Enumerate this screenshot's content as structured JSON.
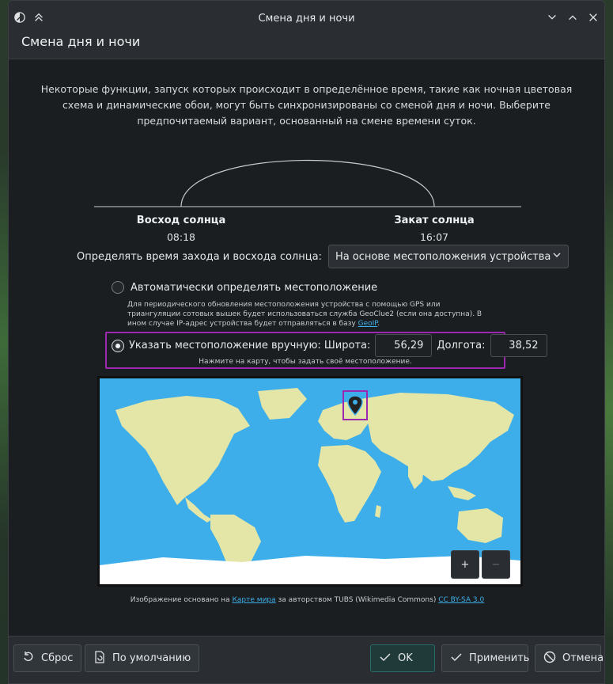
{
  "window": {
    "title": "Смена дня и ночи"
  },
  "header": {
    "title": "Смена дня и ночи"
  },
  "description": "Некоторые функции, запуск которых происходит в определённое время, такие как ночная цветовая схема и динамические обои, могут быть синхронизированы со сменой дня и ночи. Выберите предпочитаемый вариант, основанный на смене времени суток.",
  "sunrise": {
    "label": "Восход солнца",
    "time": "08:18"
  },
  "sunset": {
    "label": "Закат солнца",
    "time": "16:07"
  },
  "mode": {
    "label": "Определять время захода и восхода солнца:",
    "selected": "На основе местоположения устройства"
  },
  "auto_location": {
    "label": "Автоматически определять местоположение",
    "note_text": "Для периодического обновления местоположения устройства с помощью GPS или триангуляции сотовых вышек будет использоваться служба GeoClue2 (если она доступна). В ином случае IP-адрес устройства будет отправляться в базу",
    "note_link": "GeoIP",
    "note_end": ".",
    "checked": false
  },
  "manual_location": {
    "label": "Указать местоположение вручную: Широта:",
    "latitude": "56,29",
    "longitude_label": "Долгота:",
    "longitude": "38,52",
    "note": "Нажмите на карту, чтобы задать своё местоположение.",
    "checked": true
  },
  "map": {
    "zoom_in_label": "+",
    "zoom_out_label": "−",
    "water_color": "#3daee9",
    "land_color": "#e4e6a8",
    "ice_color": "#ffffff",
    "highlight_color": "#9c27b0"
  },
  "credit": {
    "prefix": "Изображение основано на ",
    "link1": "Карте мира",
    "middle": " за авторством TUBS (Wikimedia Commons)",
    "link2": "CC BY-SA 3.0"
  },
  "footer": {
    "reset": "Сброс",
    "defaults": "По умолчанию",
    "ok": "OK",
    "apply": "Применить",
    "cancel": "Отмена"
  }
}
